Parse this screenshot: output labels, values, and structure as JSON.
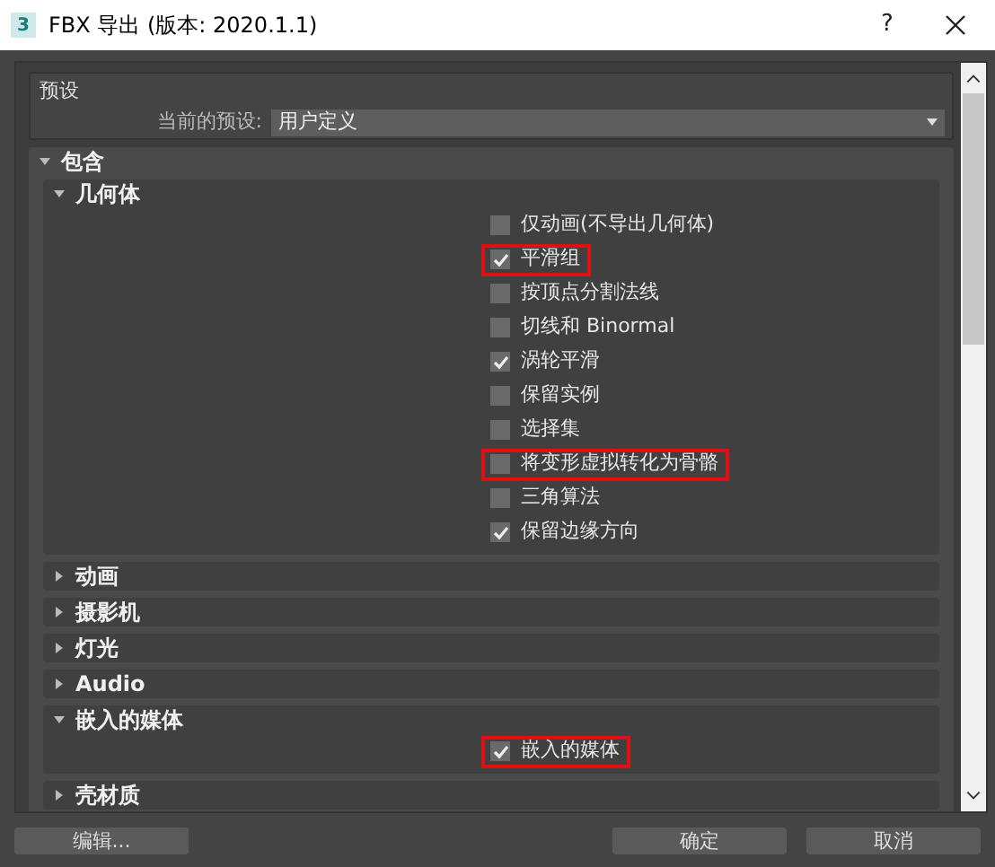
{
  "window": {
    "app_icon": "3",
    "title": "FBX 导出 (版本: 2020.1.1)",
    "help": "?"
  },
  "presets": {
    "label": "预设",
    "current_label": "当前的预设:",
    "value": "用户定义"
  },
  "sections": [
    {
      "title": "包含",
      "expanded": true,
      "subsections": [
        {
          "title": "几何体",
          "expanded": true,
          "options": [
            {
              "label": "仅动画(不导出几何体)",
              "checked": false,
              "highlighted": false
            },
            {
              "label": "平滑组",
              "checked": true,
              "highlighted": true
            },
            {
              "label": "按顶点分割法线",
              "checked": false,
              "highlighted": false
            },
            {
              "label": "切线和 Binormal",
              "checked": false,
              "highlighted": false
            },
            {
              "label": "涡轮平滑",
              "checked": true,
              "highlighted": false
            },
            {
              "label": "保留实例",
              "checked": false,
              "highlighted": false
            },
            {
              "label": "选择集",
              "checked": false,
              "highlighted": false
            },
            {
              "label": "将变形虚拟转化为骨骼",
              "checked": false,
              "highlighted": true
            },
            {
              "label": "三角算法",
              "checked": false,
              "highlighted": false
            },
            {
              "label": "保留边缘方向",
              "checked": true,
              "highlighted": false
            }
          ]
        },
        {
          "title": "动画",
          "expanded": false
        },
        {
          "title": "摄影机",
          "expanded": false
        },
        {
          "title": "灯光",
          "expanded": false
        },
        {
          "title": "Audio",
          "expanded": false
        },
        {
          "title": "嵌入的媒体",
          "expanded": true,
          "options": [
            {
              "label": "嵌入的媒体",
              "checked": true,
              "highlighted": true
            }
          ]
        },
        {
          "title": "壳材质",
          "expanded": false
        }
      ]
    }
  ],
  "buttons": [
    {
      "label": "编辑..."
    },
    {
      "label": "确定"
    },
    {
      "label": "取消"
    }
  ]
}
